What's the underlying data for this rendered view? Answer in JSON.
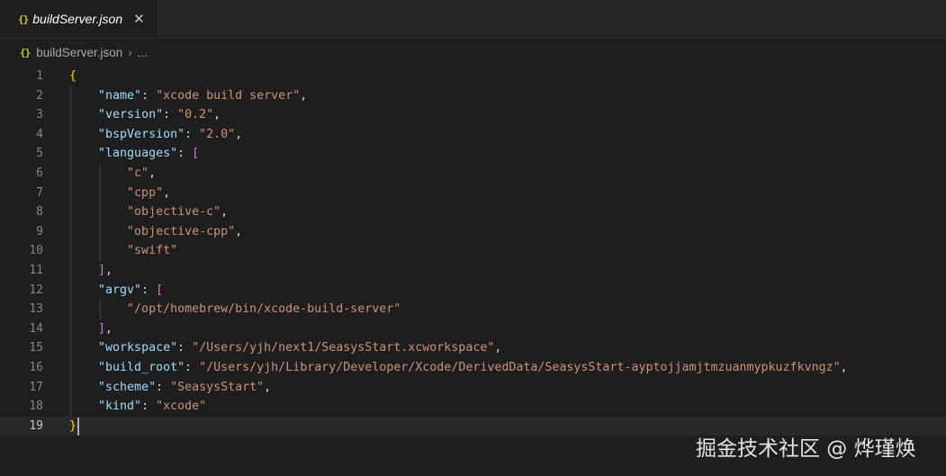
{
  "tab": {
    "icon": "{}",
    "title": "buildServer.json",
    "close_icon": "✕"
  },
  "breadcrumb": {
    "icon": "{}",
    "file": "buildServer.json",
    "separator": "›",
    "more": "..."
  },
  "editor": {
    "current_line": 19,
    "lines": [
      {
        "n": "1",
        "tokens": [
          {
            "t": "{",
            "c": "brace"
          }
        ]
      },
      {
        "n": "2",
        "tokens": [
          {
            "t": "    ",
            "c": "punc"
          },
          {
            "t": "\"name\"",
            "c": "key"
          },
          {
            "t": ": ",
            "c": "punc"
          },
          {
            "t": "\"xcode build server\"",
            "c": "str"
          },
          {
            "t": ",",
            "c": "punc"
          }
        ]
      },
      {
        "n": "3",
        "tokens": [
          {
            "t": "    ",
            "c": "punc"
          },
          {
            "t": "\"version\"",
            "c": "key"
          },
          {
            "t": ": ",
            "c": "punc"
          },
          {
            "t": "\"0.2\"",
            "c": "str"
          },
          {
            "t": ",",
            "c": "punc"
          }
        ]
      },
      {
        "n": "4",
        "tokens": [
          {
            "t": "    ",
            "c": "punc"
          },
          {
            "t": "\"bspVersion\"",
            "c": "key"
          },
          {
            "t": ": ",
            "c": "punc"
          },
          {
            "t": "\"2.0\"",
            "c": "str"
          },
          {
            "t": ",",
            "c": "punc"
          }
        ]
      },
      {
        "n": "5",
        "tokens": [
          {
            "t": "    ",
            "c": "punc"
          },
          {
            "t": "\"languages\"",
            "c": "key"
          },
          {
            "t": ": ",
            "c": "punc"
          },
          {
            "t": "[",
            "c": "bracket"
          }
        ]
      },
      {
        "n": "6",
        "tokens": [
          {
            "t": "        ",
            "c": "punc"
          },
          {
            "t": "\"c\"",
            "c": "str"
          },
          {
            "t": ",",
            "c": "punc"
          }
        ]
      },
      {
        "n": "7",
        "tokens": [
          {
            "t": "        ",
            "c": "punc"
          },
          {
            "t": "\"cpp\"",
            "c": "str"
          },
          {
            "t": ",",
            "c": "punc"
          }
        ]
      },
      {
        "n": "8",
        "tokens": [
          {
            "t": "        ",
            "c": "punc"
          },
          {
            "t": "\"objective-c\"",
            "c": "str"
          },
          {
            "t": ",",
            "c": "punc"
          }
        ]
      },
      {
        "n": "9",
        "tokens": [
          {
            "t": "        ",
            "c": "punc"
          },
          {
            "t": "\"objective-cpp\"",
            "c": "str"
          },
          {
            "t": ",",
            "c": "punc"
          }
        ]
      },
      {
        "n": "10",
        "tokens": [
          {
            "t": "        ",
            "c": "punc"
          },
          {
            "t": "\"swift\"",
            "c": "str"
          }
        ]
      },
      {
        "n": "11",
        "tokens": [
          {
            "t": "    ",
            "c": "punc"
          },
          {
            "t": "]",
            "c": "bracket"
          },
          {
            "t": ",",
            "c": "punc"
          }
        ]
      },
      {
        "n": "12",
        "tokens": [
          {
            "t": "    ",
            "c": "punc"
          },
          {
            "t": "\"argv\"",
            "c": "key"
          },
          {
            "t": ": ",
            "c": "punc"
          },
          {
            "t": "[",
            "c": "bracket"
          }
        ]
      },
      {
        "n": "13",
        "tokens": [
          {
            "t": "        ",
            "c": "punc"
          },
          {
            "t": "\"/opt/homebrew/bin/xcode-build-server\"",
            "c": "str"
          }
        ]
      },
      {
        "n": "14",
        "tokens": [
          {
            "t": "    ",
            "c": "punc"
          },
          {
            "t": "]",
            "c": "bracket"
          },
          {
            "t": ",",
            "c": "punc"
          }
        ]
      },
      {
        "n": "15",
        "tokens": [
          {
            "t": "    ",
            "c": "punc"
          },
          {
            "t": "\"workspace\"",
            "c": "key"
          },
          {
            "t": ": ",
            "c": "punc"
          },
          {
            "t": "\"/Users/yjh/next1/SeasysStart.xcworkspace\"",
            "c": "str"
          },
          {
            "t": ",",
            "c": "punc"
          }
        ]
      },
      {
        "n": "16",
        "tokens": [
          {
            "t": "    ",
            "c": "punc"
          },
          {
            "t": "\"build_root\"",
            "c": "key"
          },
          {
            "t": ": ",
            "c": "punc"
          },
          {
            "t": "\"/Users/yjh/Library/Developer/Xcode/DerivedData/SeasysStart-ayptojjamjtmzuanmypkuzfkvngz\"",
            "c": "str"
          },
          {
            "t": ",",
            "c": "punc"
          }
        ]
      },
      {
        "n": "17",
        "tokens": [
          {
            "t": "    ",
            "c": "punc"
          },
          {
            "t": "\"scheme\"",
            "c": "key"
          },
          {
            "t": ": ",
            "c": "punc"
          },
          {
            "t": "\"SeasysStart\"",
            "c": "str"
          },
          {
            "t": ",",
            "c": "punc"
          }
        ]
      },
      {
        "n": "18",
        "tokens": [
          {
            "t": "    ",
            "c": "punc"
          },
          {
            "t": "\"kind\"",
            "c": "key"
          },
          {
            "t": ": ",
            "c": "punc"
          },
          {
            "t": "\"xcode\"",
            "c": "str"
          }
        ]
      },
      {
        "n": "19",
        "tokens": [
          {
            "t": "}",
            "c": "brace"
          }
        ]
      }
    ]
  },
  "watermark": "掘金技术社区 @ 烨瑾焕",
  "colors": {
    "background": "#1e1e1e",
    "key": "#9cdcfe",
    "string": "#ce9178",
    "brace": "#ffd700",
    "bracket": "#da70d6",
    "json_icon": "#cbcb41"
  }
}
